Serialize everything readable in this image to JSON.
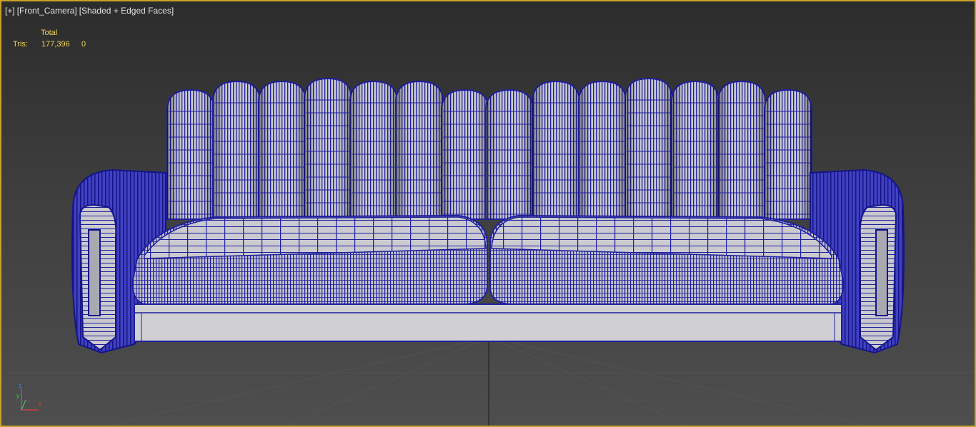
{
  "viewport": {
    "label_plus": "[+]",
    "label_camera": "[Front_Camera]",
    "label_shading": "[Shaded + Edged Faces]"
  },
  "stats": {
    "total_header": "Total",
    "tris_label": "Tris:",
    "tris_total": "177,396",
    "tris_selected": "0"
  },
  "gizmo": {
    "z": "z",
    "y": "y",
    "x": "x"
  },
  "colors": {
    "viewport_border": "#c9a227",
    "wire": "#1f1f9e",
    "surface": "#c7c7cd",
    "stats_text": "#f0d35a",
    "axis_x": "#ff3b3b",
    "axis_y": "#46d64a",
    "axis_z": "#3c8bff"
  }
}
